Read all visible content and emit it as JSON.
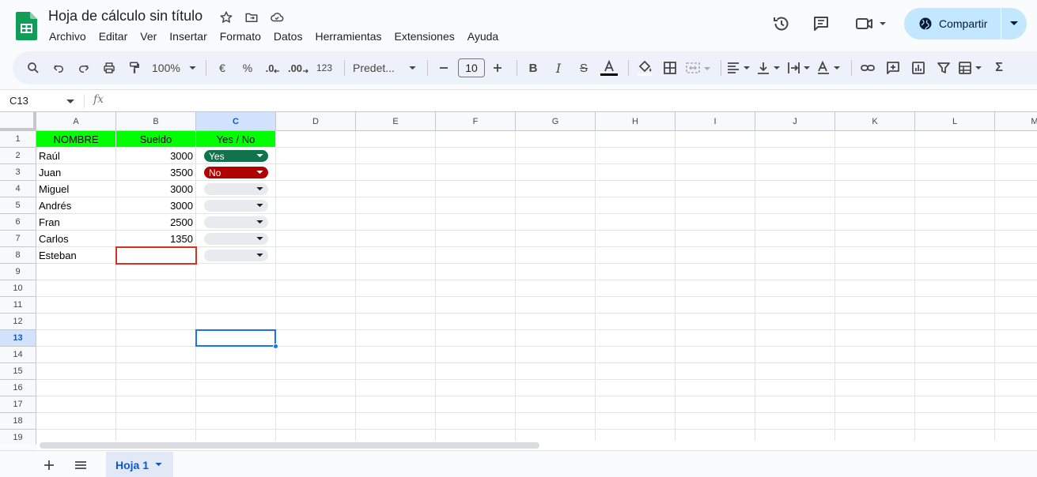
{
  "app": {
    "doc_title": "Hoja de cálculo sin título"
  },
  "menu": [
    "Archivo",
    "Editar",
    "Ver",
    "Insertar",
    "Formato",
    "Datos",
    "Herramientas",
    "Extensiones",
    "Ayuda"
  ],
  "share": {
    "label": "Compartir"
  },
  "toolbar": {
    "zoom": "100%",
    "currency": "€",
    "percent": "%",
    "dec_less": ".0",
    "dec_more": ".00",
    "number_format": "123",
    "font_family": "Predet...",
    "font_size": "10"
  },
  "formula_bar": {
    "namebox": "C13",
    "fx": "fx",
    "content": ""
  },
  "columns": [
    "A",
    "B",
    "C",
    "D",
    "E",
    "F",
    "G",
    "H",
    "I",
    "J",
    "K",
    "L",
    "M"
  ],
  "rows": [
    "1",
    "2",
    "3",
    "4",
    "5",
    "6",
    "7",
    "8",
    "9",
    "10",
    "11",
    "12",
    "13",
    "14",
    "15",
    "16",
    "17",
    "18",
    "19"
  ],
  "selected": {
    "col": "C",
    "row": "13"
  },
  "table": {
    "headers": [
      "NOMBRE",
      "Sueldo",
      "Yes / No"
    ],
    "header_bg": "#00ff00",
    "data": [
      {
        "name": "Raúl",
        "salary": "3000",
        "choice": "Yes"
      },
      {
        "name": "Juan",
        "salary": "3500",
        "choice": "No"
      },
      {
        "name": "Miguel",
        "salary": "3000",
        "choice": ""
      },
      {
        "name": "Andrés",
        "salary": "3000",
        "choice": ""
      },
      {
        "name": "Fran",
        "salary": "2500",
        "choice": ""
      },
      {
        "name": "Carlos",
        "salary": "1350",
        "choice": ""
      },
      {
        "name": "Esteban",
        "salary": "",
        "choice": ""
      }
    ]
  },
  "chip_colors": {
    "Yes": "#11734b",
    "No": "#b10202",
    "empty": "#e8eaed"
  },
  "sheet": {
    "name": "Hoja 1"
  }
}
